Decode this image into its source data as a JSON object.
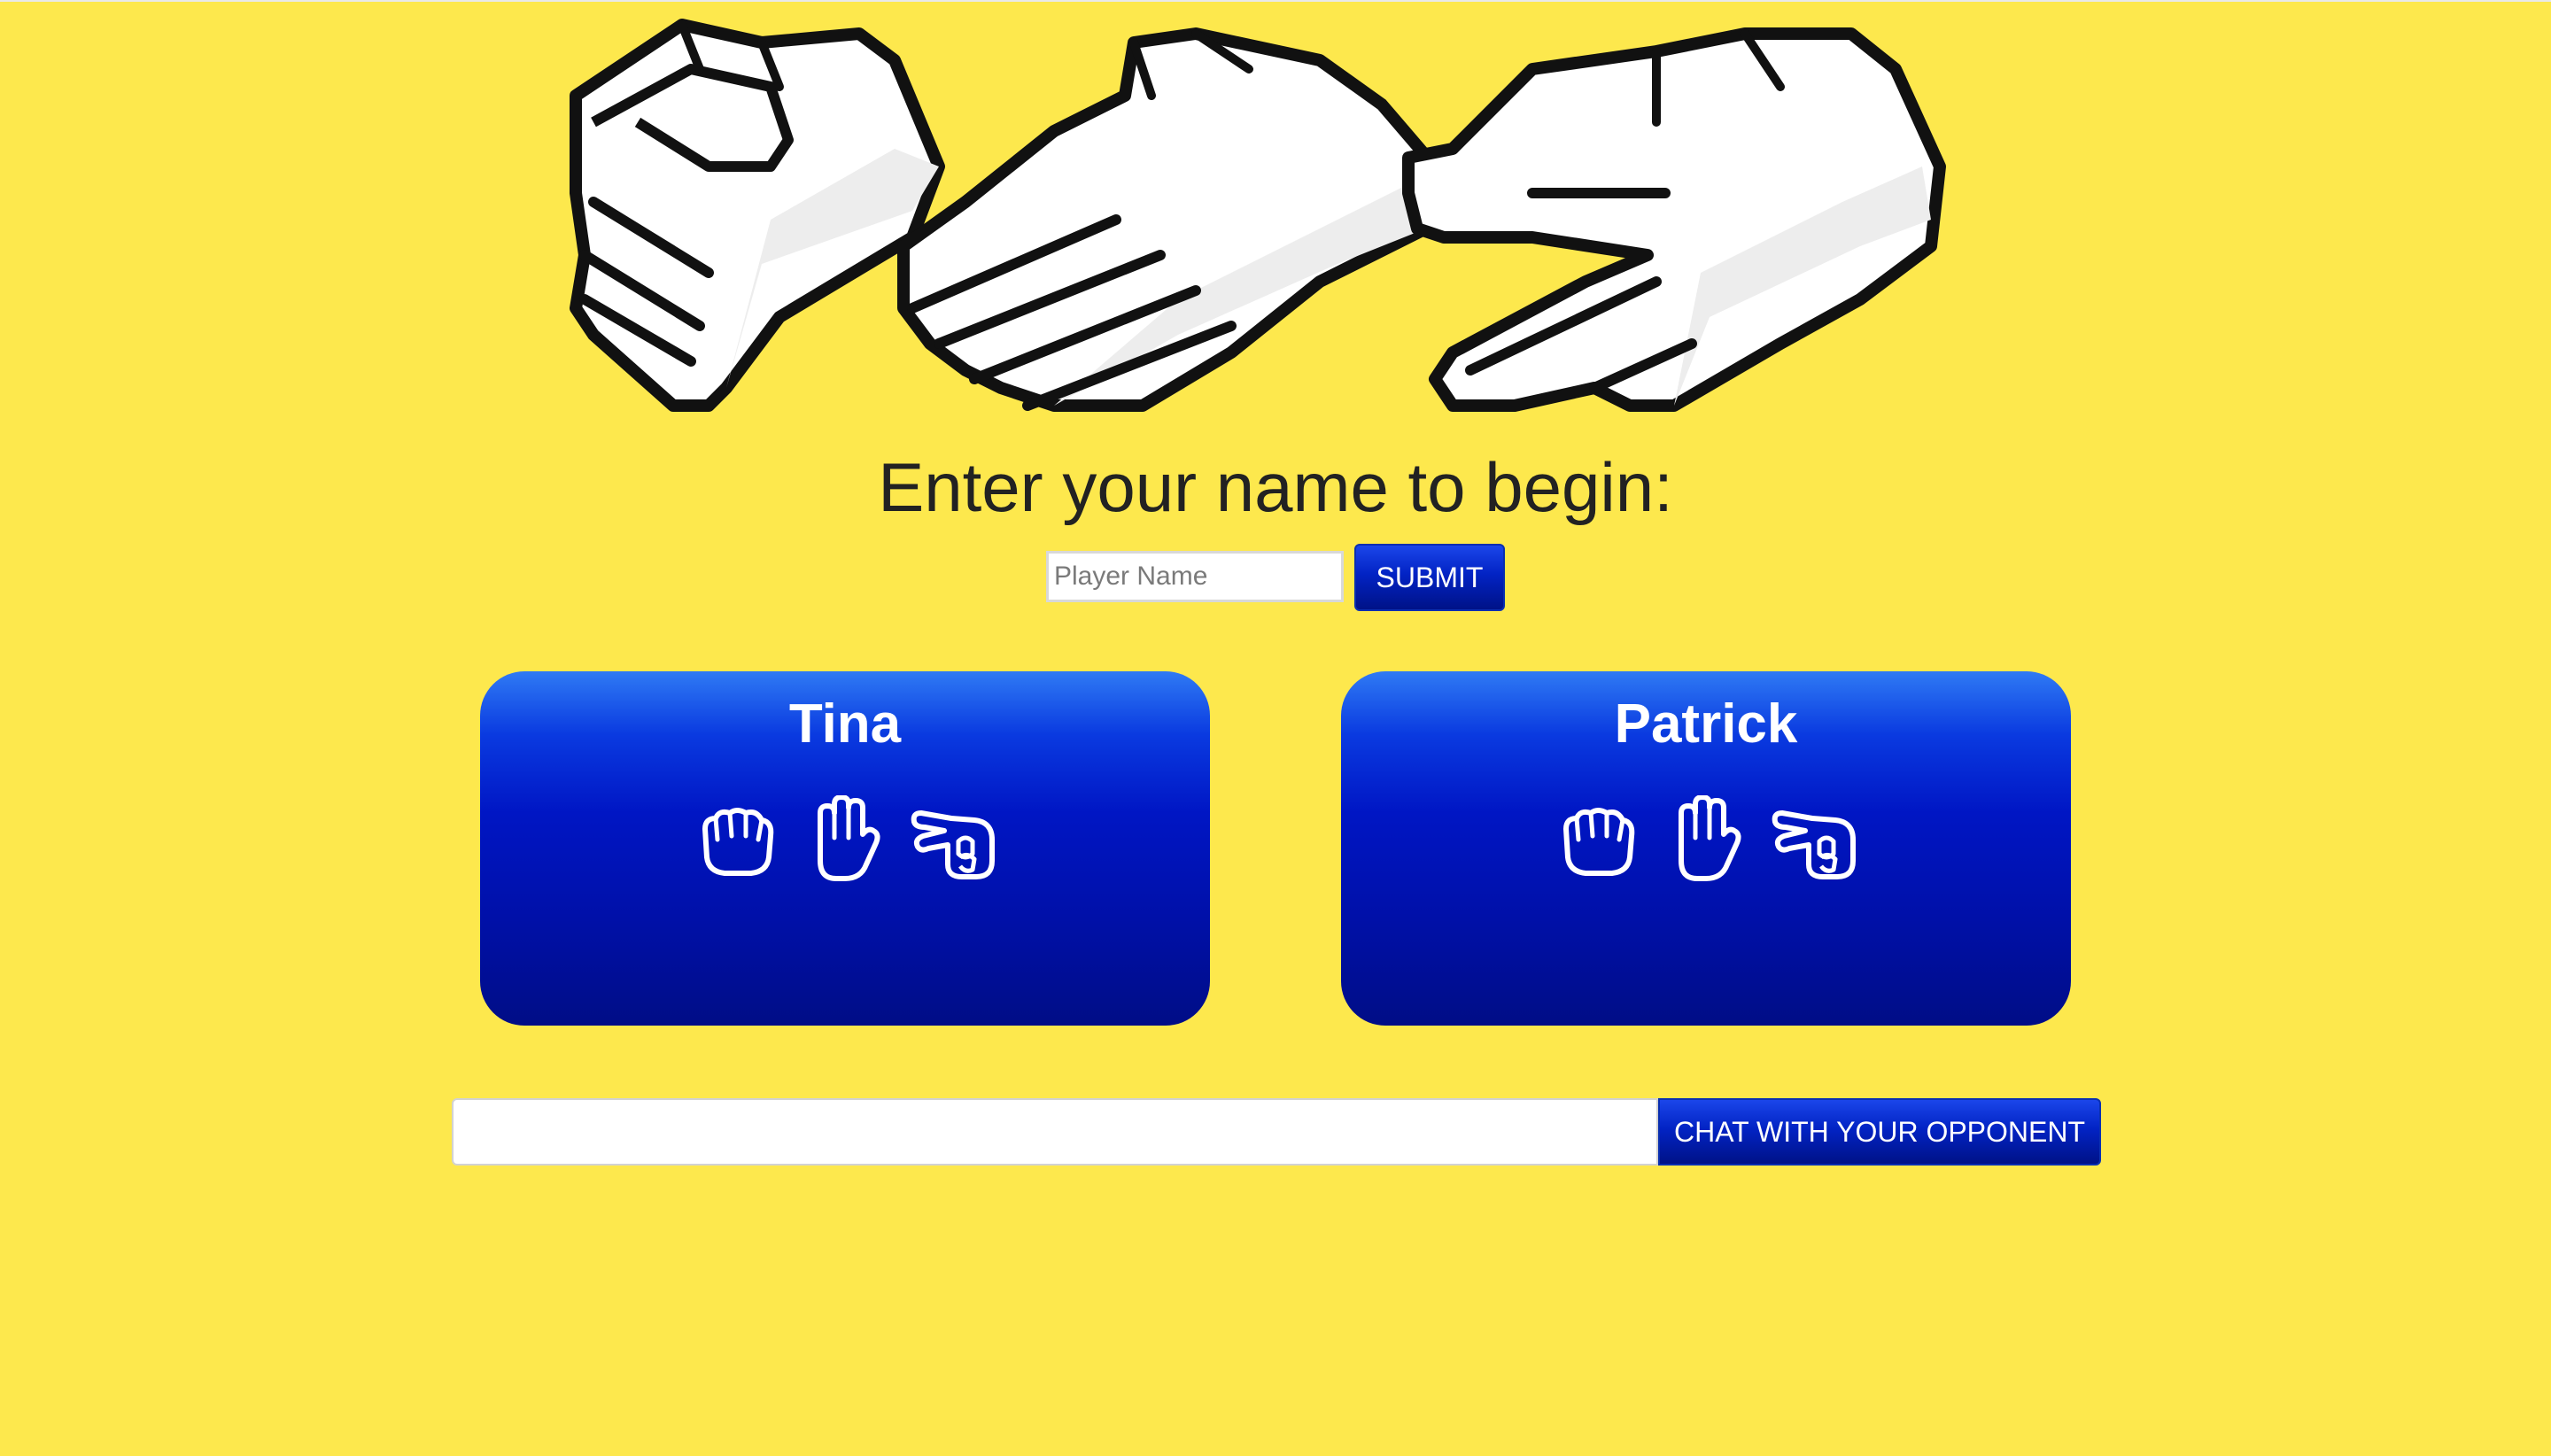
{
  "colors": {
    "background": "#FDE84D",
    "card_top": "#2f7af4",
    "card_bottom": "#000d86",
    "button": "#0223c4",
    "text_dark": "#222222"
  },
  "hero": {
    "icons": [
      "rock-hand-icon",
      "paper-hand-icon",
      "scissors-hand-icon"
    ]
  },
  "prompt": {
    "title": "Enter your name to begin:",
    "name_placeholder": "Player Name",
    "name_value": "",
    "submit_label": "SUBMIT"
  },
  "players": [
    {
      "name": "Tina",
      "moves": [
        "rock-icon",
        "paper-icon",
        "scissors-icon"
      ]
    },
    {
      "name": "Patrick",
      "moves": [
        "rock-icon",
        "paper-icon",
        "scissors-icon"
      ]
    }
  ],
  "chat": {
    "input_value": "",
    "button_label": "CHAT WITH YOUR OPPONENT"
  }
}
